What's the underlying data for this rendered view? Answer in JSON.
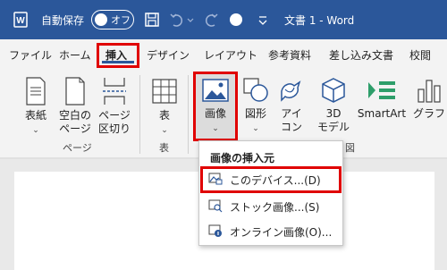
{
  "titlebar": {
    "autosave_label": "自動保存",
    "autosave_state": "オフ",
    "document_title": "文書 1 - Word",
    "bg_color": "#2b579a"
  },
  "tabs": [
    {
      "label": "ファイル"
    },
    {
      "label": "ホーム"
    },
    {
      "label": "挿入",
      "active": true
    },
    {
      "label": "デザイン"
    },
    {
      "label": "レイアウト"
    },
    {
      "label": "参考資料"
    },
    {
      "label": "差し込み文書"
    },
    {
      "label": "校閲"
    }
  ],
  "ribbon": {
    "cover_page": {
      "line1": "表紙"
    },
    "blank_page": {
      "line1": "空白の",
      "line2": "ページ"
    },
    "page_break": {
      "line1": "ページ",
      "line2": "区切り"
    },
    "table": {
      "line1": "表"
    },
    "pictures": {
      "line1": "画像"
    },
    "shapes": {
      "line1": "図形"
    },
    "icons": {
      "line1": "アイ",
      "line2": "コン"
    },
    "models_3d": {
      "line1": "3D",
      "line2": "モデル"
    },
    "smartart": {
      "line1": "SmartArt"
    },
    "chart": {
      "line1": "グラフ"
    },
    "groups": {
      "pages": "ページ",
      "tables": "表",
      "illustrations_partial": "図"
    }
  },
  "dropdown": {
    "header": "画像の挿入元",
    "items": [
      {
        "label": "このデバイス...(D)",
        "icon": "device-picture-icon"
      },
      {
        "label": "ストック画像...(S)",
        "icon": "stock-images-icon"
      },
      {
        "label": "オンライン画像(O)...",
        "icon": "online-pictures-icon"
      }
    ]
  },
  "accent": "#e00000"
}
